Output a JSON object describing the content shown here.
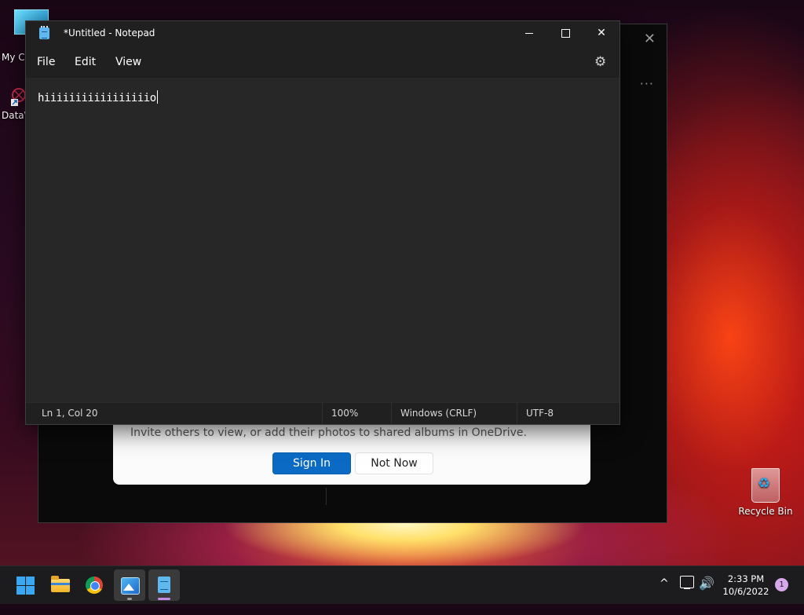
{
  "desktop": {
    "icons": [
      {
        "label": "My Co",
        "icon": "computer-icon"
      },
      {
        "label": "DataW",
        "icon": "app-shortcut-icon"
      },
      {
        "label": "Recycle Bin",
        "icon": "recycle-bin-icon"
      }
    ]
  },
  "photos_window": {
    "onedrive_prompt": {
      "message": "Invite others to view, or add their photos to shared albums in OneDrive.",
      "sign_in_label": "Sign In",
      "not_now_label": "Not Now"
    },
    "close_glyph": "✕",
    "more_glyph": "···"
  },
  "notepad": {
    "title": "*Untitled - Notepad",
    "menu": [
      "File",
      "Edit",
      "View"
    ],
    "content": "hiiiiiiiiiiiiiiiiio",
    "status": {
      "position": "Ln 1, Col 20",
      "zoom": "100%",
      "line_ending": "Windows (CRLF)",
      "encoding": "UTF-8"
    },
    "controls": {
      "minimize": "minimize-icon",
      "maximize": "maximize-icon",
      "close": "close-icon",
      "close_glyph": "✕"
    },
    "settings_glyph": "⚙"
  },
  "taskbar": {
    "apps": [
      "Start",
      "File Explorer",
      "Google Chrome",
      "Photos",
      "Notepad"
    ],
    "tray": {
      "chevron_glyph": "^",
      "volume_glyph": "🔊",
      "time": "2:33 PM",
      "date": "10/6/2022",
      "notification_count": "1"
    }
  },
  "colors": {
    "accent": "#0b6bc4",
    "notepad_bg": "#272727",
    "taskbar_bg": "#1c1c1e"
  }
}
